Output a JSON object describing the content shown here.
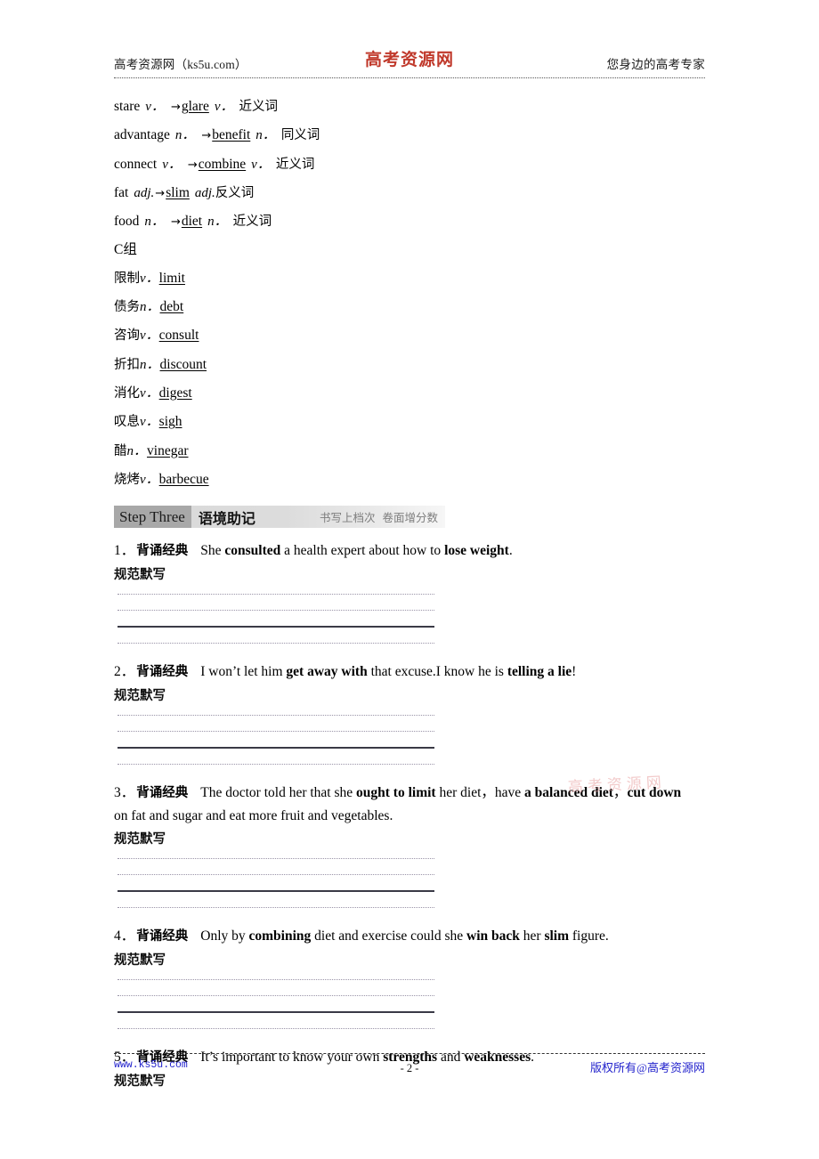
{
  "header": {
    "left": "高考资源网（ks5u.com）",
    "center_logo": "高考资源网",
    "right": "您身边的高考专家"
  },
  "footer": {
    "left": "www.ks5u.com",
    "page_number": "- 2 -",
    "right": "版权所有@高考资源网"
  },
  "word_pairs": [
    {
      "word": "stare",
      "pos1": "v．",
      "arrow": "→",
      "syn": "glare",
      "pos2": "v．",
      "relation": "近义词"
    },
    {
      "word": "advantage",
      "pos1": "n．",
      "arrow": "→",
      "syn": "benefit",
      "pos2": "n．",
      "relation": "同义词"
    },
    {
      "word": "connect",
      "pos1": "v．",
      "arrow": "→",
      "syn": "combine",
      "pos2": "v．",
      "relation": "近义词"
    },
    {
      "word": "fat",
      "pos1": "adj.",
      "arrow": "→",
      "syn": "slim",
      "pos2": "adj.",
      "relation": "反义词"
    },
    {
      "word": "food",
      "pos1": "n．",
      "arrow": "→",
      "syn": "diet",
      "pos2": "n．",
      "relation": "近义词"
    }
  ],
  "group_c": {
    "title_letter": "C",
    "title_cn": "组",
    "entries": [
      {
        "cn": "限制",
        "pos": "v．",
        "en": "limit"
      },
      {
        "cn": "债务",
        "pos": "n．",
        "en": "debt"
      },
      {
        "cn": "咨询",
        "pos": "v．",
        "en": "consult"
      },
      {
        "cn": "折扣",
        "pos": "n．",
        "en": "discount"
      },
      {
        "cn": "消化",
        "pos": "v．",
        "en": "digest"
      },
      {
        "cn": "叹息",
        "pos": "v．",
        "en": "sigh"
      },
      {
        "cn": "醋",
        "pos": "n．",
        "en": "vinegar"
      },
      {
        "cn": "烧烤",
        "pos": "v．",
        "en": "barbecue"
      }
    ]
  },
  "step_banner": {
    "chip": "Step Three",
    "title": "语境助记",
    "tag1": "书写上档次",
    "tag2": "卷面增分数"
  },
  "recite": {
    "tag_label": "背诵经典",
    "write_label": "规范默写",
    "watermark": "高考资源网",
    "items": [
      {
        "num": "1．",
        "line1_parts": [
          {
            "t": "She ",
            "b": false
          },
          {
            "t": "consulted",
            "b": true
          },
          {
            "t": " a health expert about how to ",
            "b": false
          },
          {
            "t": "lose weight",
            "b": true
          },
          {
            "t": ".",
            "b": false
          }
        ],
        "line2_parts": []
      },
      {
        "num": "2．",
        "line1_parts": [
          {
            "t": "I won’t let him ",
            "b": false
          },
          {
            "t": "get away with",
            "b": true
          },
          {
            "t": " that excuse.I know he is ",
            "b": false
          },
          {
            "t": "telling a lie",
            "b": true
          },
          {
            "t": "!",
            "b": false
          }
        ],
        "line2_parts": []
      },
      {
        "num": "3．",
        "line1_parts": [
          {
            "t": "The doctor told her that she ",
            "b": false
          },
          {
            "t": "ought to limit",
            "b": true
          },
          {
            "t": " her diet，have ",
            "b": false
          },
          {
            "t": "a balanced diet",
            "b": true
          },
          {
            "t": "，",
            "b": false
          },
          {
            "t": "cut down",
            "b": true
          }
        ],
        "line2_parts": [
          {
            "t": "on fat and sugar and eat more fruit and vegetables.",
            "b": false
          }
        ]
      },
      {
        "num": "4．",
        "line1_parts": [
          {
            "t": "Only by ",
            "b": false
          },
          {
            "t": "combining",
            "b": true
          },
          {
            "t": " diet and exercise could she ",
            "b": false
          },
          {
            "t": "win back",
            "b": true
          },
          {
            "t": " her ",
            "b": false
          },
          {
            "t": "slim",
            "b": true
          },
          {
            "t": " figure.",
            "b": false
          }
        ],
        "line2_parts": []
      },
      {
        "num": "5．",
        "line1_parts": [
          {
            "t": "It’s important to know your own ",
            "b": false
          },
          {
            "t": "strengths",
            "b": true
          },
          {
            "t": " and ",
            "b": false
          },
          {
            "t": "weaknesses",
            "b": true
          },
          {
            "t": ".",
            "b": false
          }
        ],
        "line2_parts": []
      }
    ]
  }
}
